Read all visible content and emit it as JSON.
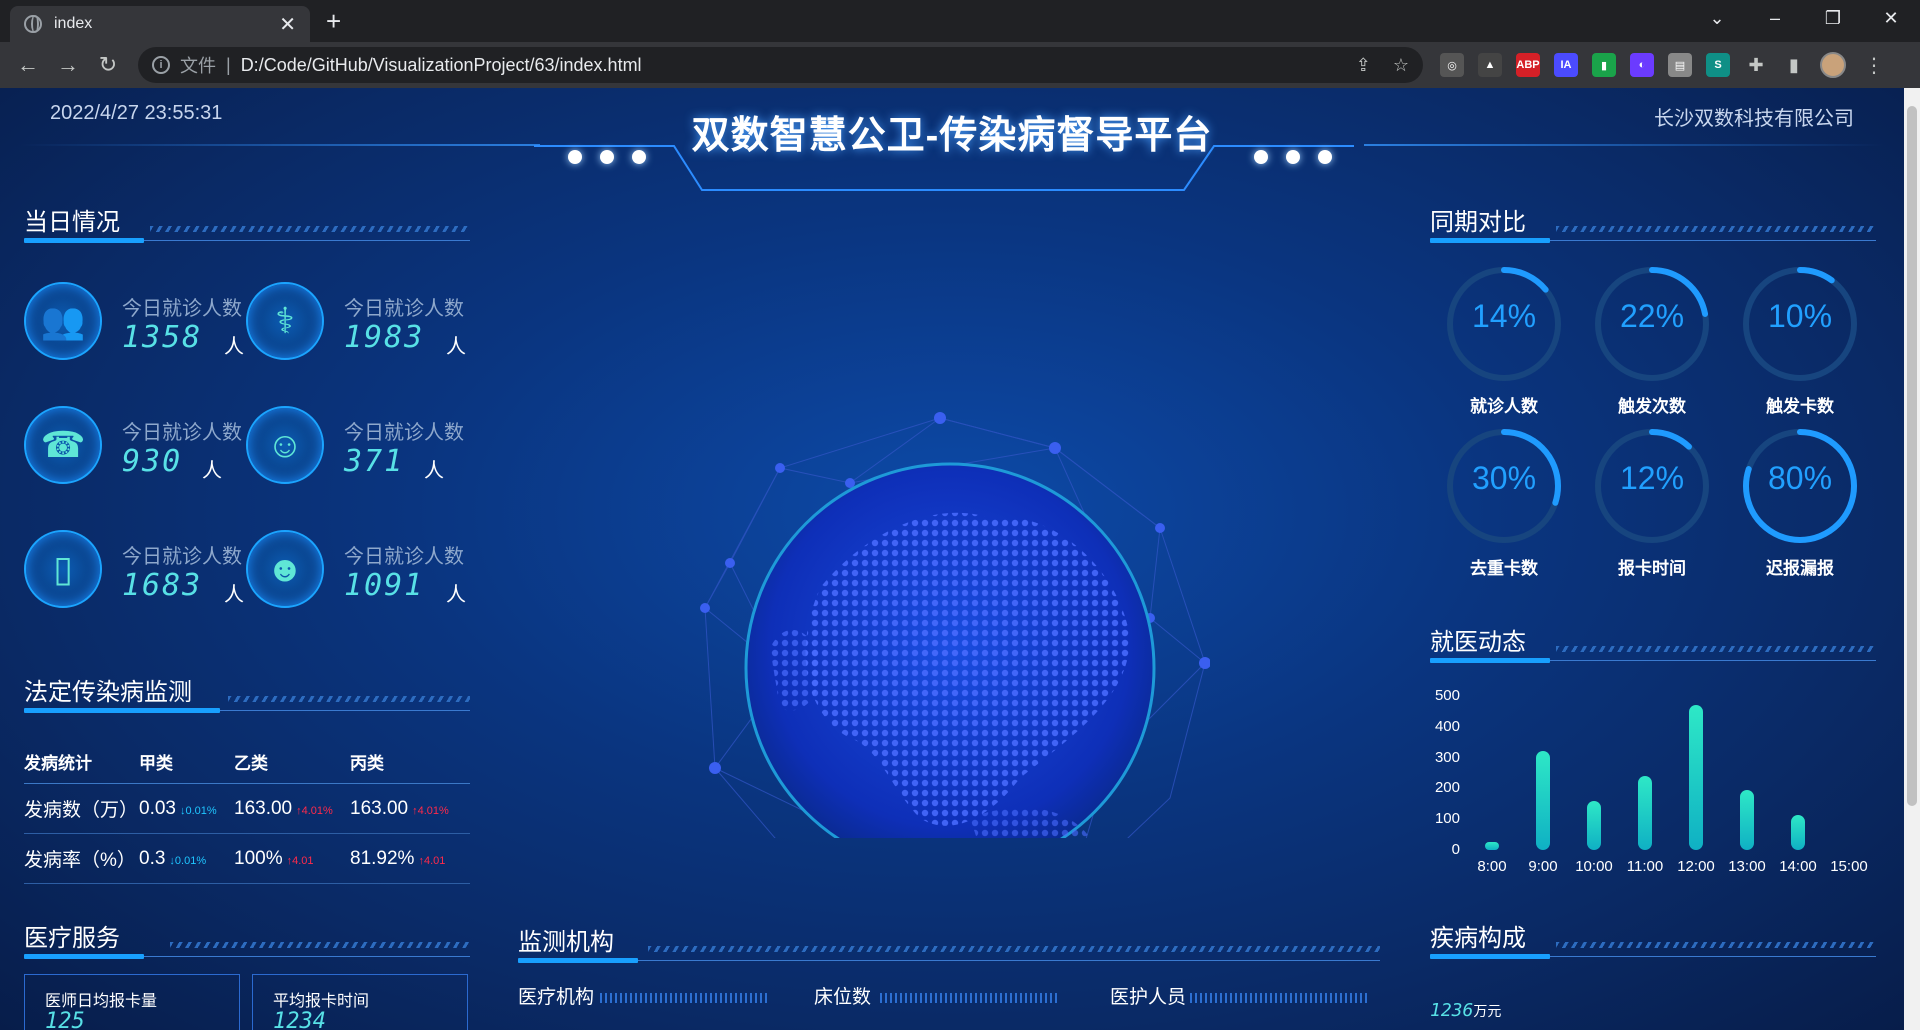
{
  "browser": {
    "tab_title": "index",
    "url_prefix": "文件",
    "url": "D:/Code/GitHub/VisualizationProject/63/index.html",
    "extensions": [
      {
        "name": "glasses",
        "label": "◎",
        "color": "#555"
      },
      {
        "name": "triangle",
        "label": "▲",
        "color": "#444"
      },
      {
        "name": "abp",
        "label": "ABP",
        "color": "#d52027"
      },
      {
        "name": "ia",
        "label": "IA",
        "color": "#4b4bff"
      },
      {
        "name": "bookmark-green",
        "label": "▮",
        "color": "#1aa34a"
      },
      {
        "name": "moon",
        "label": "◐",
        "color": "#6b3bff"
      },
      {
        "name": "page",
        "label": "▤",
        "color": "#888"
      },
      {
        "name": "s",
        "label": "S",
        "color": "#0f8f86"
      }
    ]
  },
  "header": {
    "datetime": "2022/4/27 23:55:31",
    "title": "双数智慧公卫-传染病督导平台",
    "company": "长沙双数科技有限公司"
  },
  "daily": {
    "title": "当日情况",
    "stats": [
      {
        "label": "今日就诊人数",
        "value": "1358",
        "unit": "人",
        "icon": "people-group-icon",
        "glyph": "👥"
      },
      {
        "label": "今日就诊人数",
        "value": "1983",
        "unit": "人",
        "icon": "doctor-patient-icon",
        "glyph": "⚕"
      },
      {
        "label": "今日就诊人数",
        "value": "930",
        "unit": "人",
        "icon": "headset-icon",
        "glyph": "☎"
      },
      {
        "label": "今日就诊人数",
        "value": "371",
        "unit": "人",
        "icon": "nurse-icon",
        "glyph": "☺"
      },
      {
        "label": "今日就诊人数",
        "value": "1683",
        "unit": "人",
        "icon": "phone-icon",
        "glyph": "▯"
      },
      {
        "label": "今日就诊人数",
        "value": "1091",
        "unit": "人",
        "icon": "user-icon",
        "glyph": "☻"
      }
    ]
  },
  "disease": {
    "title": "法定传染病监测",
    "headers": [
      "发病统计",
      "甲类",
      "乙类",
      "丙类"
    ],
    "rows": [
      {
        "label": "发病数（万）",
        "a": "0.03",
        "a_ch": "↓0.01%",
        "b": "163.00",
        "b_ch": "↑4.01%",
        "c": "163.00",
        "c_ch": "↑4.01%"
      },
      {
        "label": "发病率（%）",
        "a": "0.3",
        "a_ch": "↓0.01%",
        "b": "100%",
        "b_ch": "↑4.01",
        "c": "81.92%",
        "c_ch": "↑4.01"
      }
    ]
  },
  "medical": {
    "title": "医疗服务",
    "cards": [
      {
        "label": "医师日均报卡量",
        "value": "125"
      },
      {
        "label": "平均报卡时间",
        "value": "1234"
      }
    ]
  },
  "monitor": {
    "title": "监测机构",
    "items": [
      "医疗机构",
      "床位数",
      "医护人员"
    ]
  },
  "compare": {
    "title": "同期对比",
    "rings": [
      {
        "pct": 14,
        "label": "就诊人数"
      },
      {
        "pct": 22,
        "label": "触发次数"
      },
      {
        "pct": 10,
        "label": "触发卡数"
      },
      {
        "pct": 30,
        "label": "去重卡数"
      },
      {
        "pct": 12,
        "label": "报卡时间"
      },
      {
        "pct": 80,
        "label": "迟报漏报"
      }
    ]
  },
  "visits": {
    "title": "就医动态"
  },
  "chart_data": {
    "type": "bar",
    "categories": [
      "8:00",
      "9:00",
      "10:00",
      "11:00",
      "12:00",
      "13:00",
      "14:00",
      "15:00"
    ],
    "values": [
      25,
      320,
      160,
      240,
      470,
      195,
      115,
      0
    ],
    "ylim": [
      0,
      500
    ],
    "yticks": [
      "500",
      "400",
      "300",
      "200",
      "100",
      "0"
    ],
    "title": "",
    "xlabel": "",
    "ylabel": ""
  },
  "composition": {
    "title": "疾病构成",
    "value": "1236",
    "unit": "万元"
  }
}
